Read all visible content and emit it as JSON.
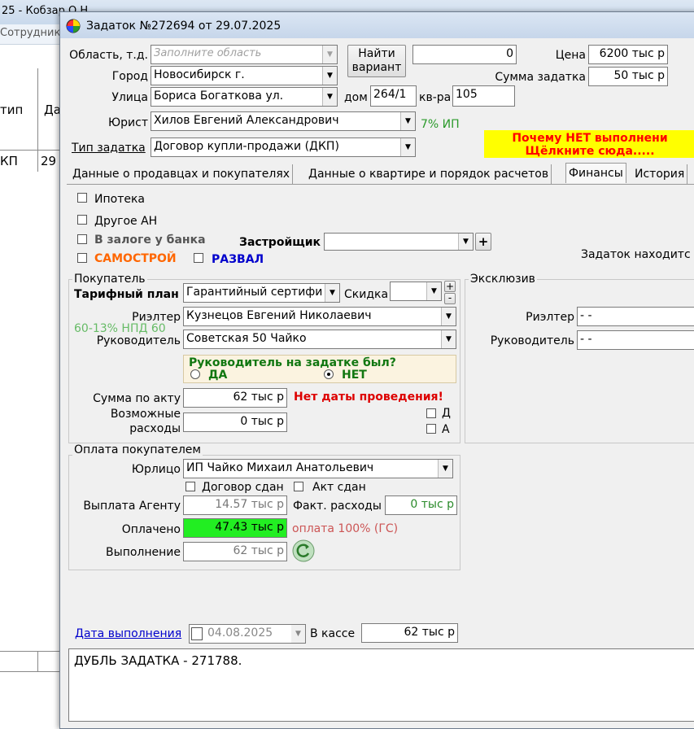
{
  "background": {
    "title": "25 - Кобзар О.Н.",
    "menu_item": "Сотрудник",
    "col_type": "тип",
    "col_date": "Да",
    "row_type": "КП",
    "row_date": "29"
  },
  "window": {
    "title": "Задаток №272694 от 29.07.2025"
  },
  "header": {
    "region_label": "Область, т.д.",
    "region_placeholder": "Заполните область",
    "find_button": "Найти вариант",
    "find_value": "0",
    "price_label": "Цена",
    "price_value": "6200 тыс р",
    "deposit_sum_label": "Сумма задатка",
    "deposit_sum_value": "50 тыс р",
    "city_label": "Город",
    "city_value": "Новосибирск г.",
    "street_label": "Улица",
    "street_value": "Бориса Богаткова ул.",
    "house_label": "дом",
    "house_value": "264/1",
    "flat_label": "кв-ра",
    "flat_value": "105",
    "lawyer_label": "Юрист",
    "lawyer_value": "Хилов Евгений Александрович",
    "lawyer_pct": "7% ИП",
    "deposit_type_label": "Тип задатка",
    "deposit_type_value": "Договор купли-продажи (ДКП)",
    "warning_line1": "Почему НЕТ выполнени",
    "warning_line2": "Щёлкните сюда....."
  },
  "tabs": [
    {
      "label": "Данные о продавцах и покупателях"
    },
    {
      "label": "Данные о квартире и порядок расчетов"
    },
    {
      "label": "Финансы"
    },
    {
      "label": "История"
    }
  ],
  "finance": {
    "mortgage": "Ипотека",
    "other_agency": "Другое АН",
    "bank_pledge": "В залоге у банка",
    "developer_label": "Застройщик",
    "samostroy": "САМОСТРОЙ",
    "razval": "РАЗВАЛ",
    "deposit_location": "Задаток находитс",
    "buyer_group": "Покупатель",
    "tariff_label": "Тарифный план",
    "tariff_value": "Гарантийный сертифи",
    "discount_label": "Скидка",
    "plus": "+",
    "minus": "-",
    "realtor_label": "Риэлтер",
    "realtor_value": "Кузнецов Евгений Николаевич",
    "npd_note": "60-13% НПД 60",
    "manager_label": "Руководитель",
    "manager_value": "Советская 50 Чайко",
    "manager_question": "Руководитель на задатке  был?",
    "yes": "ДА",
    "no": "НЕТ",
    "act_sum_label": "Сумма по акту",
    "act_sum_value": "62 тыс р",
    "no_date": "Нет даты проведения!",
    "expenses_label1": "Возможные",
    "expenses_label2": "расходы",
    "expenses_value": "0 тыс р",
    "chk_d": "Д",
    "chk_a": "А",
    "exclusive_group": "Эксклюзив",
    "ex_realtor_label": "Риэлтер",
    "ex_realtor_value": "- -",
    "ex_manager_label": "Руководитель",
    "ex_manager_value": "- -",
    "payment_group": "Оплата покупателем",
    "legal_label": "Юрлицо",
    "legal_value": "ИП Чайко Михаил Анатольевич",
    "contract_handed": "Договор сдан",
    "act_handed": "Акт сдан",
    "agent_payout_label": "Выплата Агенту",
    "agent_payout_value": "14.57 тыс р",
    "fact_expenses_label": "Факт. расходы",
    "fact_expenses_value": "0 тыс р",
    "paid_label": "Оплачено",
    "paid_value": "47.43 тыс р",
    "paid_note": "оплата 100% (ГС)",
    "completion_label": "Выполнение",
    "completion_value": "62 тыс р",
    "completion_date_label": "Дата выполнения",
    "completion_date_value": "04.08.2025",
    "cash_label": "В кассе",
    "cash_value": "62 тыс р",
    "note_text": "ДУБЛЬ ЗАДАТКА - 271788."
  },
  "colors": {
    "paid_bg": "#22ee22",
    "warning_bg": "#ffff00",
    "warning_text": "#ff0000",
    "green_text": "#2a8a2a",
    "orange_text": "#ff6600",
    "blue_text": "#0000cc"
  }
}
